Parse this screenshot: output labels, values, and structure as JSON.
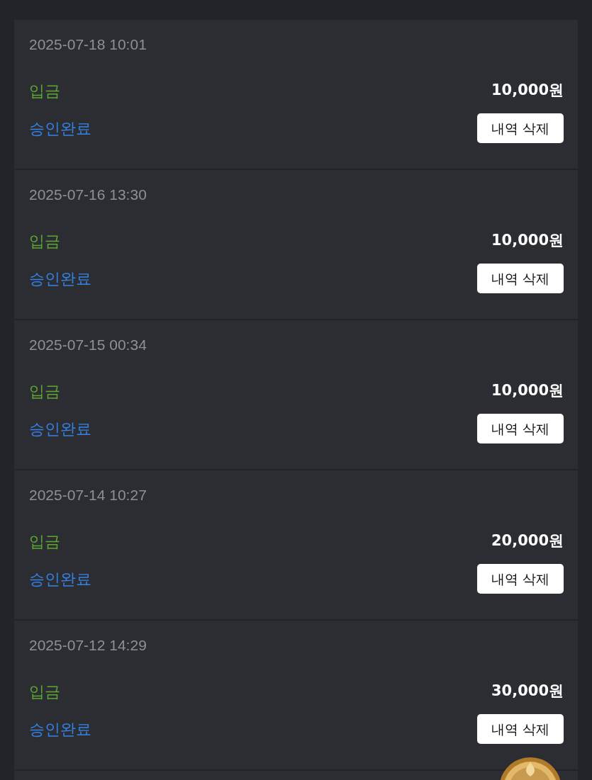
{
  "records": [
    {
      "datetime": "2025-07-18 10:01",
      "type": "입금",
      "amount": "10,000원",
      "status": "승인완료",
      "button": "내역 삭제"
    },
    {
      "datetime": "2025-07-16 13:30",
      "type": "입금",
      "amount": "10,000원",
      "status": "승인완료",
      "button": "내역 삭제"
    },
    {
      "datetime": "2025-07-15 00:34",
      "type": "입금",
      "amount": "10,000원",
      "status": "승인완료",
      "button": "내역 삭제"
    },
    {
      "datetime": "2025-07-14 10:27",
      "type": "입금",
      "amount": "20,000원",
      "status": "승인완료",
      "button": "내역 삭제"
    },
    {
      "datetime": "2025-07-12 14:29",
      "type": "입금",
      "amount": "30,000원",
      "status": "승인완료",
      "button": "내역 삭제"
    }
  ]
}
